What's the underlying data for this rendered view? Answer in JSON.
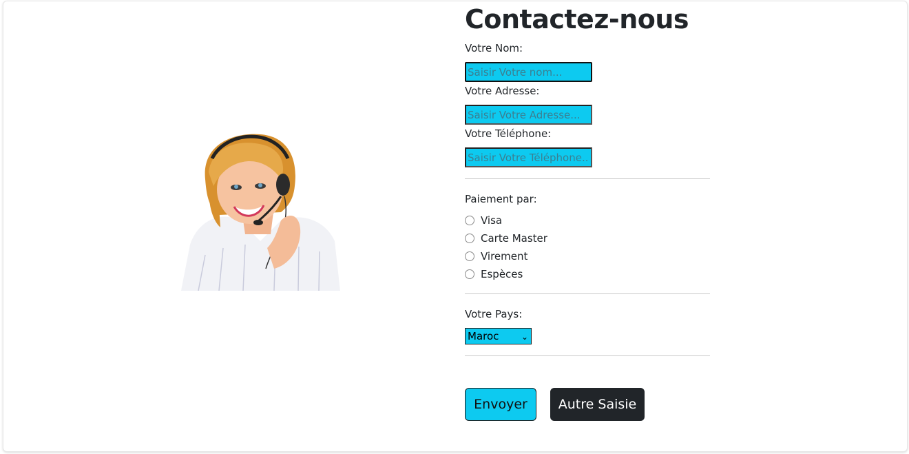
{
  "form": {
    "title": "Contactez-nous",
    "name_label": "Votre Nom:",
    "name_placeholder": "Saisir Votre nom...",
    "address_label": "Votre Adresse:",
    "address_placeholder": "Saisir Votre Adresse...",
    "phone_label": "Votre Téléphone:",
    "phone_placeholder": "Saisir Votre Téléphone...",
    "payment_label": "Paiement par:",
    "payment_options": [
      "Visa",
      "Carte Master",
      "Virement",
      "Espèces"
    ],
    "country_label": "Votre Pays:",
    "country_selected": "Maroc",
    "submit_label": "Envoyer",
    "reset_label": "Autre Saisie"
  },
  "image": {
    "icon": "support-agent-with-headset"
  },
  "colors": {
    "accent": "#0dcaf0",
    "dark": "#212529"
  }
}
